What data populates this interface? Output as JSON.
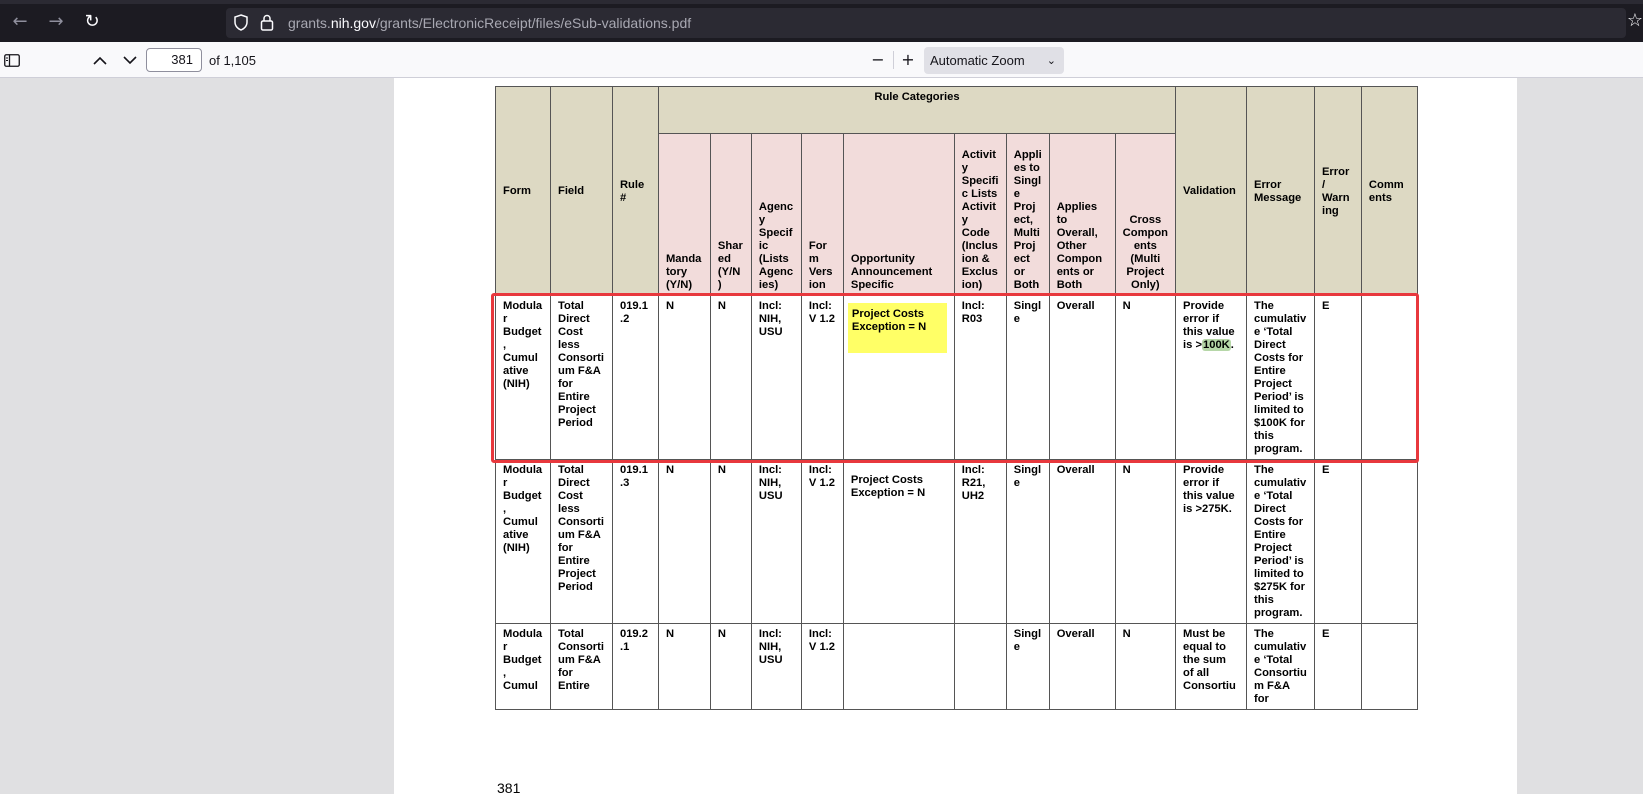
{
  "browser": {
    "url_prefix": "grants.",
    "url_host": "nih.gov",
    "url_path": "/grants/ElectronicReceipt/files/eSub-validations.pdf"
  },
  "pdf_toolbar": {
    "current_page": "381",
    "page_count": "of 1,105",
    "zoom": "Automatic Zoom"
  },
  "table": {
    "header_group": "Rule Categories",
    "headers": {
      "form": "Form",
      "field": "Field",
      "rule": "Rule #",
      "mandatory": "Manda tory (Y/N)",
      "shared": "Shar ed (Y/N )",
      "agency": "Agenc y Specif ic (Lists Agenc ies)",
      "form_version": "For m Vers ion",
      "opportunity": "Opportunity Announcement Specific",
      "activity": "Activit y Specifi c Lists Activit y Code (Inclus ion & Exclus ion)",
      "applies_single": "Appli es to Singl e Proj ect, Multi Proj ect or Both",
      "applies_overall": "Applies to Overall, Other Compon ents or Both",
      "cross": "Cross Compon ents (Multi Project Only)",
      "validation": "Validation",
      "error_message": "Error Message",
      "error_warning": "Error / Warn ing",
      "comments": "Comm ents"
    },
    "rows": [
      {
        "form": "Modula r Budget , Cumul ative (NIH)",
        "field": "Total Direct Cost less Consorti um F&A for Entire Project Period",
        "rule": "019.1 .2",
        "mandatory": "N",
        "shared": "N",
        "agency": "Incl: NIH, USU",
        "form_version": "Incl: V 1.2",
        "opportunity": "Project Costs Exception = N",
        "activity": "Incl: R03",
        "applies_single": "Singl e",
        "applies_overall": "Overall",
        "cross": "N",
        "validation_prefix": "Provide error if this value is >",
        "validation_highlight": "100K",
        "validation_suffix": ".",
        "error_message": "The cumulativ e ‘Total Direct Costs for Entire Project Period’ is limited to $100K for this program.",
        "error_warning": "E",
        "comments": ""
      },
      {
        "form": "Modula r Budget , Cumul ative (NIH)",
        "field": "Total Direct Cost less Consorti um F&A for Entire Project Period",
        "rule": "019.1 .3",
        "mandatory": "N",
        "shared": "N",
        "agency": "Incl: NIH, USU",
        "form_version": "Incl: V 1.2",
        "opportunity": "Project Costs Exception = N",
        "activity": "Incl: R21, UH2",
        "applies_single": "Singl e",
        "applies_overall": "Overall",
        "cross": "N",
        "validation": "Provide error if this value is >275K.",
        "error_message": "The cumulativ e ‘Total Direct Costs for Entire Project Period’ is limited to $275K for this program.",
        "error_warning": "E",
        "comments": ""
      },
      {
        "form": "Modula r Budget , Cumul",
        "field": "Total Consorti um F&A for Entire",
        "rule": "019.2 .1",
        "mandatory": "N",
        "shared": "N",
        "agency": "Incl: NIH, USU",
        "form_version": "Incl: V 1.2",
        "opportunity": "",
        "activity": "",
        "applies_single": "Singl e",
        "applies_overall": "Overall",
        "cross": "N",
        "validation": "Must be equal to the sum of all Consortiu",
        "error_message": "The cumulativ e ‘Total Consortiu m F&A for",
        "error_warning": "E",
        "comments": ""
      }
    ]
  },
  "page_number": "381",
  "colors": {
    "header_tan": "#ddd9c3",
    "header_pink": "#f2dcdb",
    "highlight_yellow": "#ffff66",
    "highlight_green": "#b6d7a8",
    "annotation_red": "#e8383d"
  }
}
